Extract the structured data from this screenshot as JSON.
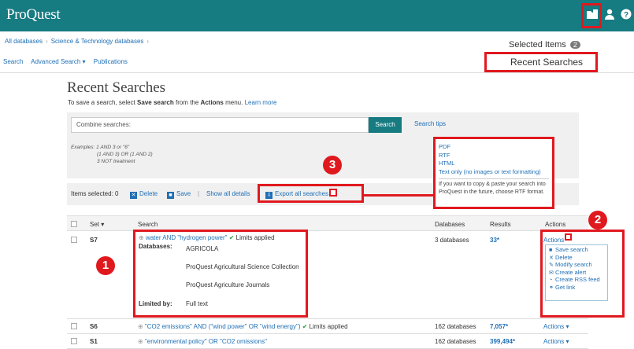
{
  "header": {
    "logo": "ProQuest",
    "icons": [
      "folder-icon",
      "user-icon",
      "help-icon"
    ]
  },
  "breadcrumb": [
    "All databases",
    "Science & Technology databases"
  ],
  "nav": {
    "search": "Search",
    "advanced": "Advanced Search",
    "advanced_caret": "▾",
    "publications": "Publications"
  },
  "selected_items": {
    "label": "Selected Items",
    "count": "2"
  },
  "recent_searches_link": "Recent Searches",
  "page": {
    "title": "Recent Searches",
    "subtitle_pre": "To save a search, select ",
    "subtitle_bold": "Save search",
    "subtitle_mid": " from the ",
    "subtitle_bold2": "Actions",
    "subtitle_post": " menu.",
    "learn_more": "Learn more"
  },
  "combine": {
    "placeholder": "Combine searches:",
    "button": "Search",
    "tips": "Search tips",
    "examples_label": "Examples:",
    "examples": [
      "1 AND 3 or \"6\"",
      "(1 AND 3) OR (1 AND 2)",
      "3 NOT treatment"
    ]
  },
  "toolbar": {
    "items_selected": "Items selected: 0",
    "delete": "Delete",
    "save": "Save",
    "divider": "|",
    "show_all": "Show all details",
    "export": "Export all searches"
  },
  "export_menu": {
    "options": [
      "PDF",
      "RTF",
      "HTML",
      "Text only (no images or text formatting)"
    ],
    "note": "If you want to copy & paste your search into ProQuest in the future, choose RTF format."
  },
  "callouts": [
    "1",
    "2",
    "3"
  ],
  "table": {
    "headers": {
      "set": "Set",
      "set_sort": "▾",
      "search": "Search",
      "databases": "Databases",
      "results": "Results",
      "actions": "Actions"
    },
    "rows": [
      {
        "set": "S7",
        "query": "water AND \"hydrogen power\"",
        "limits": "Limits applied",
        "databases_label": "Databases:",
        "databases_list": [
          "AGRICOLA",
          "ProQuest Agricultural Science Collection",
          "ProQuest Agriculture Journals"
        ],
        "limited_by_label": "Limited by:",
        "limited_by": "Full text",
        "db_count": "3 databases",
        "results": "33*",
        "actions": "Actions"
      },
      {
        "set": "S6",
        "query": "\"CO2 emissions\" AND (\"wind power\" OR \"wind energy\")",
        "limits": "Limits applied",
        "db_count": "162 databases",
        "results": "7,057*",
        "actions": "Actions"
      },
      {
        "set": "S1",
        "query": "\"environmental policy\" OR \"CO2 omissions\"",
        "db_count": "162 databases",
        "results": "399,494*",
        "actions": "Actions"
      }
    ]
  },
  "actions_menu": [
    "Save search",
    "Delete",
    "Modify search",
    "Create alert",
    "Create RSS feed",
    "Get link"
  ]
}
